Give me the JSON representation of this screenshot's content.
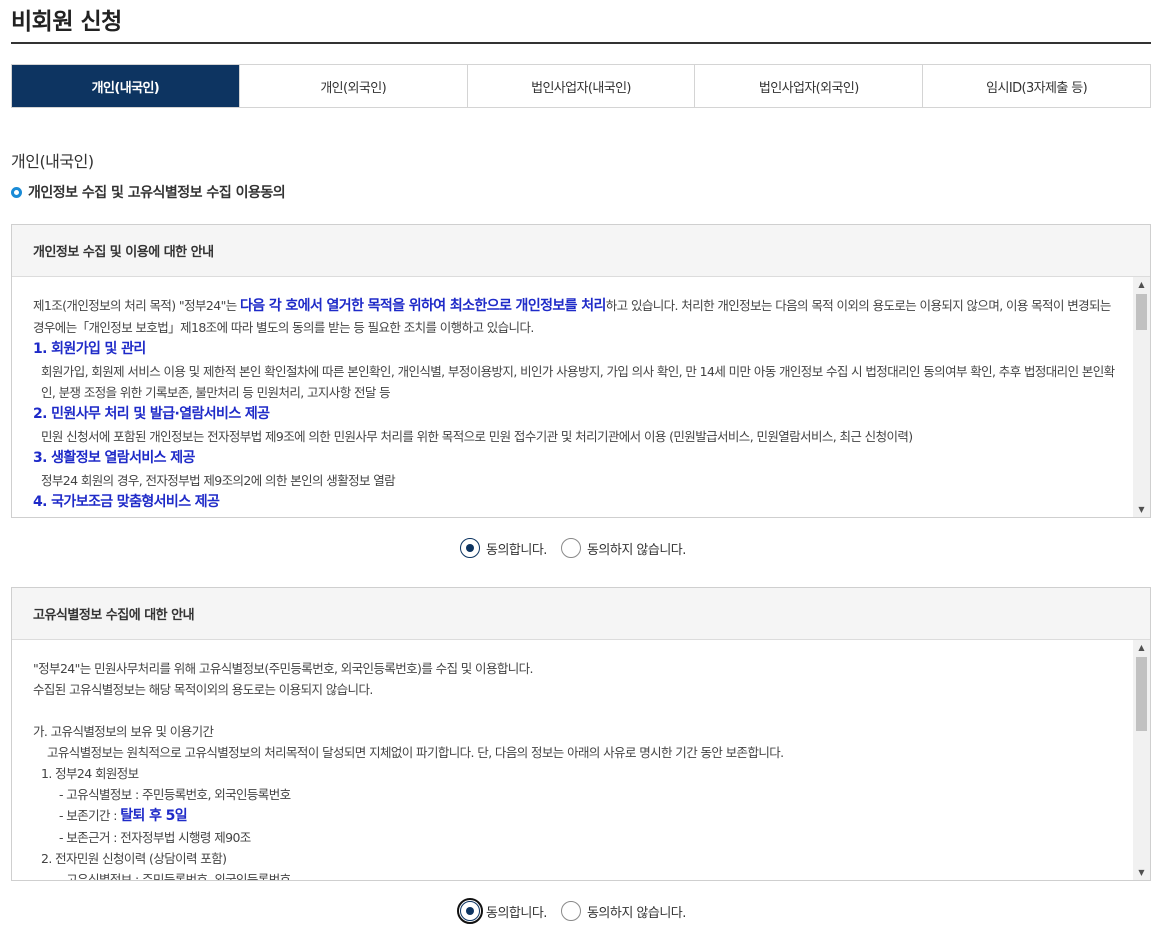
{
  "page": {
    "title": "비회원 신청"
  },
  "tabs": [
    {
      "label": "개인(내국인)",
      "active": true
    },
    {
      "label": "개인(외국인)",
      "active": false
    },
    {
      "label": "법인사업자(내국인)",
      "active": false
    },
    {
      "label": "법인사업자(외국인)",
      "active": false
    },
    {
      "label": "임시ID(3자제출 등)",
      "active": false
    }
  ],
  "section": {
    "title": "개인(내국인)",
    "consent_heading": "개인정보 수집 및 고유식별정보 수집 이용동의"
  },
  "privacy_box": {
    "header": "개인정보 수집 및 이용에 대한 안내",
    "intro_a": "제1조(개인정보의 처리 목적) \"정부24\"는 ",
    "intro_highlight": "다음 각 호에서 열거한 목적을 위하여 최소한으로 개인정보를 처리",
    "intro_b": "하고 있습니다. 처리한 개인정보는 다음의 목적 이외의 용도로는 이용되지 않으며, 이용 목적이 변경되는 경우에는「개인정보 보호법」제18조에 따라 별도의 동의를 받는 등 필요한 조치를 이행하고 있습니다.",
    "items": [
      {
        "heading": "1. 회원가입 및 관리",
        "text": "회원가입, 회원제 서비스 이용 및 제한적 본인 확인절차에 따른 본인확인, 개인식별, 부정이용방지, 비인가 사용방지, 가입 의사 확인, 만 14세 미만 아동 개인정보 수집 시 법정대리인 동의여부 확인, 추후 법정대리인 본인확인, 분쟁 조정을 위한 기록보존, 불만처리 등 민원처리, 고지사항 전달 등"
      },
      {
        "heading": "2. 민원사무 처리 및 발급·열람서비스 제공",
        "text": "민원 신청서에 포함된 개인정보는 전자정부법 제9조에 의한 민원사무 처리를 위한 목적으로 민원 접수기관 및 처리기관에서 이용 (민원발급서비스, 민원열람서비스, 최근 신청이력)"
      },
      {
        "heading": "3. 생활정보 열람서비스 제공",
        "text": "정부24 회원의 경우, 전자정부법 제9조의2에 의한 본인의 생활정보 열람"
      },
      {
        "heading": "4. 국가보조금 맞춤형서비스 제공",
        "text": ""
      }
    ]
  },
  "privacy_radios": {
    "agree": "동의합니다.",
    "disagree": "동의하지 않습니다."
  },
  "unique_box": {
    "header": "고유식별정보 수집에 대한 안내",
    "line1": "\"정부24\"는 민원사무처리를 위해 고유식별정보(주민등록번호, 외국인등록번호)를 수집 및 이용합니다.",
    "line2": "수집된 고유식별정보는 해당 목적이외의 용도로는 이용되지 않습니다.",
    "ga_heading": "가. 고유식별정보의 보유 및 이용기간",
    "ga_text": "고유식별정보는 원칙적으로 고유식별정보의 처리목적이 달성되면 지체없이 파기합니다. 단, 다음의 정보는 아래의 사유로 명시한 기간 동안 보존합니다.",
    "sub1_heading": "1. 정부24 회원정보",
    "sub1_item1": "- 고유식별정보 : 주민등록번호, 외국인등록번호",
    "sub1_item2_label": "- 보존기간 : ",
    "sub1_item2_value": "탈퇴 후 5일",
    "sub1_item3": "- 보존근거 : 전자정부법 시행령 제90조",
    "sub2_heading": "2. 전자민원 신청이력 (상담이력 포함)",
    "sub2_item1": "- 고유식별정보 : 주민등록번호, 외국인등록번호"
  },
  "unique_radios": {
    "agree": "동의합니다.",
    "disagree": "동의하지 않습니다."
  },
  "colors": {
    "tab_active_bg": "#0d3461",
    "highlight_blue": "#1e2ac8",
    "bullet_ring": "#1a8bd6"
  }
}
